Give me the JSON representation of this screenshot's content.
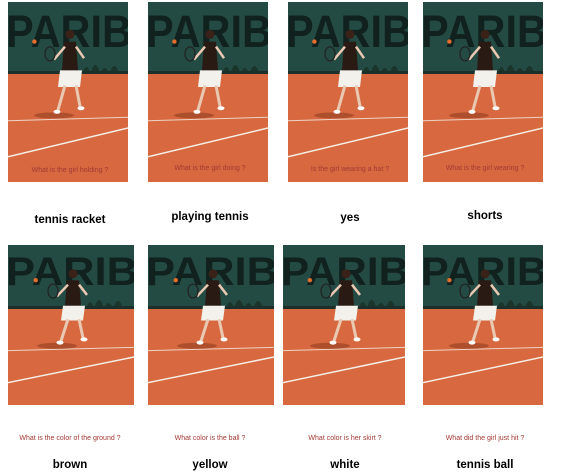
{
  "colors": {
    "backdrop": "#244a44",
    "clay": "#d7683f",
    "line": "#f4efe6",
    "banner_text": "#0e1a18",
    "question": "#a23a35",
    "answer": "#000000"
  },
  "banner_text": "PARIB",
  "items": [
    {
      "question": "What is the girl holding ?",
      "answer": "tennis racket"
    },
    {
      "question": "What is the girl doing ?",
      "answer": "playing tennis"
    },
    {
      "question": "Is the girl wearing a hat ?",
      "answer": "yes"
    },
    {
      "question": "What is the girl wearing ?",
      "answer": "shorts"
    },
    {
      "question": "What is the color of the ground ?",
      "answer": "brown"
    },
    {
      "question": "What color is the ball ?",
      "answer": "yellow"
    },
    {
      "question": "What color is her skirt ?",
      "answer": "white"
    },
    {
      "question": "What did the girl just hit ?",
      "answer": "tennis ball"
    }
  ]
}
